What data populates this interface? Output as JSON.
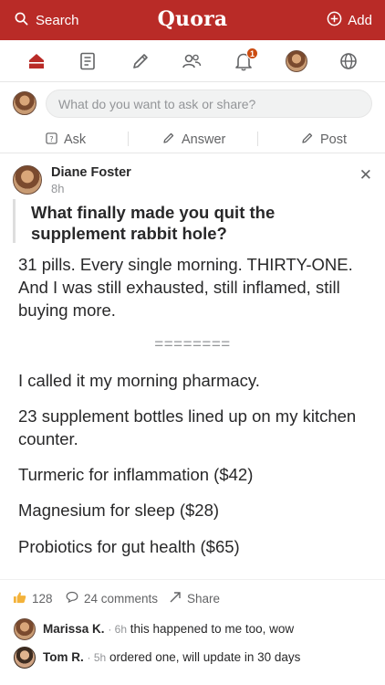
{
  "header": {
    "search_label": "Search",
    "logo": "Quora",
    "add_label": "Add"
  },
  "nav": {
    "notification_count": "1",
    "icons": [
      "home-icon",
      "following-icon",
      "pencil-icon",
      "spaces-icon",
      "bell-icon",
      "avatar",
      "globe-icon"
    ]
  },
  "ask": {
    "placeholder": "What do you want to ask or share?"
  },
  "actions": {
    "ask": "Ask",
    "answer": "Answer",
    "post": "Post"
  },
  "post": {
    "author": "Diane Foster",
    "time": "8h",
    "question": "What finally made you quit the supplement rabbit hole?",
    "paragraphs": [
      "31 pills. Every single morning. THIRTY-ONE. And I was still exhausted, still inflamed, still buying more.",
      "I called it my morning pharmacy.",
      "23 supplement bottles lined up on my kitchen counter.",
      "Turmeric for inflammation ($42)",
      "Magnesium for sleep ($28)",
      "Probiotics for gut health ($65)"
    ],
    "divider": "========"
  },
  "footer": {
    "upvotes": "128",
    "comments": "24 comments",
    "share": "Share"
  },
  "comments": [
    {
      "name": "Marissa K.",
      "time": "6h",
      "text": "this happened to me too, wow"
    },
    {
      "name": "Tom R.",
      "time": "5h",
      "text": "ordered one, will update in 30 days"
    }
  ],
  "colors": {
    "brand": "#b92b27",
    "badge": "#cb4b10",
    "active_nav": "#b92b27"
  }
}
